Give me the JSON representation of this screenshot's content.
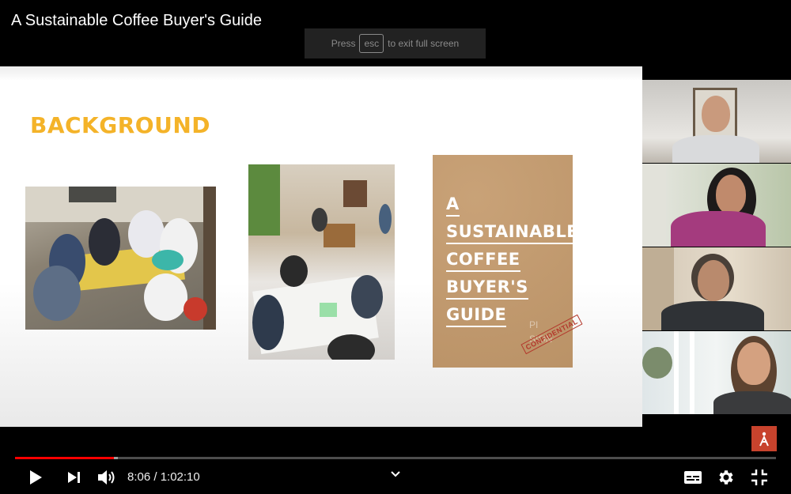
{
  "video": {
    "title": "A Sustainable Coffee Buyer's Guide",
    "fullscreen_hint": {
      "before": "Press",
      "key": "esc",
      "after": "to exit full screen"
    }
  },
  "slide": {
    "heading": "BACKGROUND",
    "cover": {
      "title_lines": [
        "A",
        "SUSTAINABLE",
        "COFFEE",
        "BUYER'S",
        "GUIDE"
      ],
      "stamp": "CONFIDENTIAL",
      "faded_text": [
        "PI",
        "SION"
      ]
    }
  },
  "participants": [
    "participant-1",
    "participant-2",
    "participant-3",
    "participant-4"
  ],
  "player": {
    "current_time": "8:06",
    "duration": "1:02:10",
    "time_display": "8:06 / 1:02:10",
    "played_fraction": 0.13,
    "buffered_fraction": 0.135,
    "accent_color": "#ff0000",
    "icons": [
      "play-icon",
      "next-icon",
      "volume-icon",
      "chevron-down-icon",
      "subtitles-icon",
      "settings-gear-icon",
      "exit-fullscreen-icon"
    ]
  }
}
